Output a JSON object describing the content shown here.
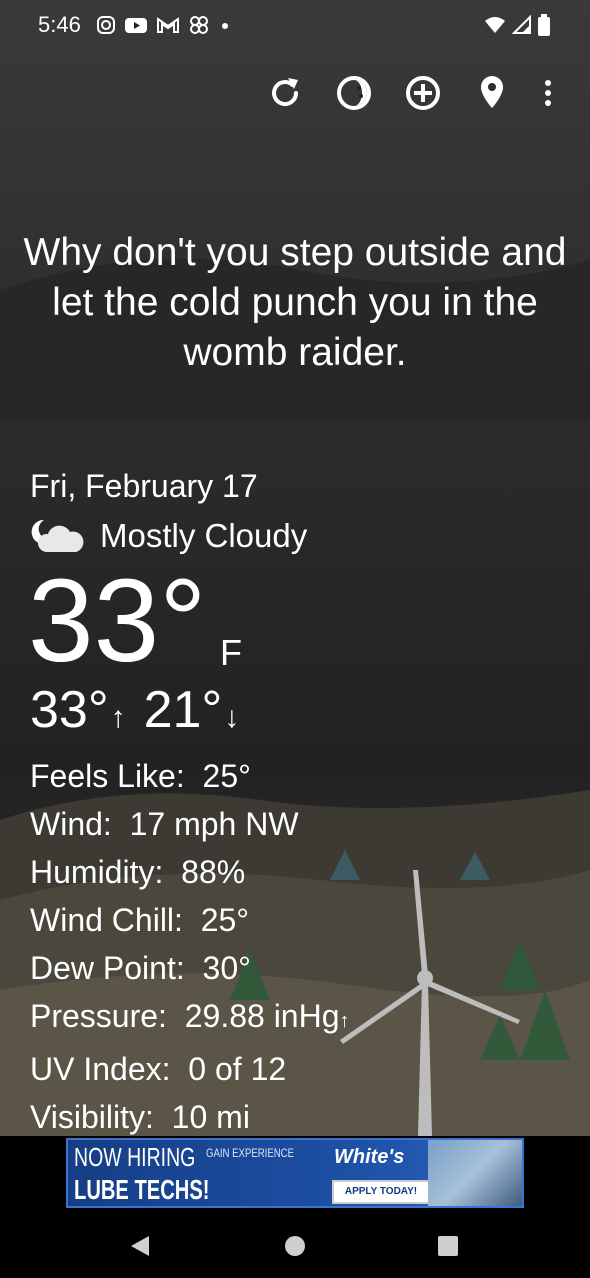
{
  "status_bar": {
    "time": "5:46",
    "left_icons": [
      "instagram-icon",
      "youtube-icon",
      "gmail-icon",
      "pinwheel-icon",
      "dot-icon"
    ],
    "right_icons": [
      "wifi-icon",
      "signal-icon",
      "battery-icon"
    ]
  },
  "toolbar": {
    "buttons": [
      "refresh-icon",
      "theme-icon",
      "add-location-icon",
      "location-pin-icon",
      "more-options-icon"
    ]
  },
  "quote": "Why don't you step outside and let the cold punch you in the womb raider.",
  "weather": {
    "date": "Fri, February 17",
    "condition": "Mostly Cloudy",
    "condition_icon": "partly-cloudy-night-icon",
    "temperature": "33°",
    "unit": "F",
    "high": "33°",
    "high_arrow": "↑",
    "low": "21°",
    "low_arrow": "↓"
  },
  "details": {
    "feels_like_label": "Feels Like:",
    "feels_like": "25°",
    "wind_label": "Wind:",
    "wind": "17 mph NW",
    "humidity_label": "Humidity:",
    "humidity": "88%",
    "wind_chill_label": "Wind Chill:",
    "wind_chill": "25°",
    "dew_point_label": "Dew Point:",
    "dew_point": "30°",
    "pressure_label": "Pressure:",
    "pressure": "29.88 inHg",
    "pressure_arrow": "↑",
    "uv_label": "UV Index:",
    "uv": "0 of 12",
    "visibility_label": "Visibility:",
    "visibility": "10 mi"
  },
  "ad": {
    "headline": "NOW HIRING",
    "subline": "LUBE TECHS!",
    "tag": "GAIN EXPERIENCE",
    "brand": "White's",
    "cta": "APPLY TODAY!"
  },
  "colors": {
    "background": "#1e1e1e",
    "text": "#ffffff",
    "ad_blue": "#1d4fa3"
  }
}
